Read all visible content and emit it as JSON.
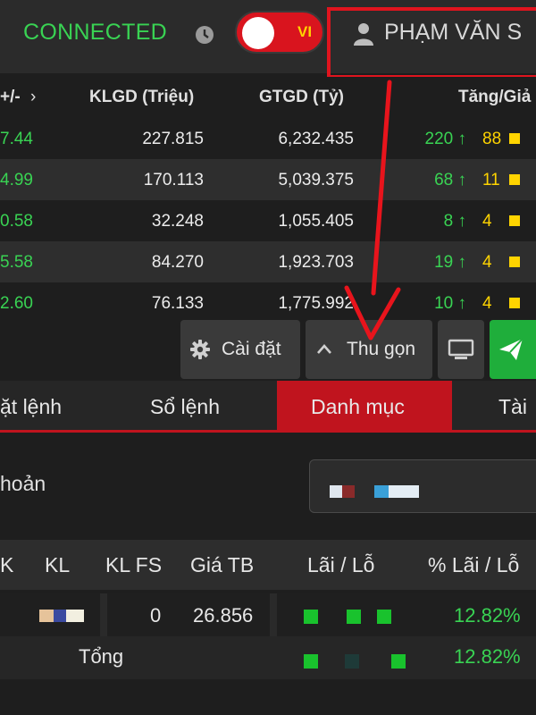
{
  "header": {
    "status": "CONNECTED",
    "language": "VI",
    "user_name": "PHẠM VĂN S"
  },
  "market": {
    "columns": {
      "change": "+/-",
      "klgd": "KLGD (Triệu)",
      "gtgd": "GTGD (Tỷ)",
      "updown": "Tăng/Giả"
    },
    "rows": [
      {
        "change": "7.44",
        "klgd": "227.815",
        "gtgd": "6,232.435",
        "up": "220",
        "ref": "88"
      },
      {
        "change": "4.99",
        "klgd": "170.113",
        "gtgd": "5,039.375",
        "up": "68",
        "ref": "11"
      },
      {
        "change": "0.58",
        "klgd": "32.248",
        "gtgd": "1,055.405",
        "up": "8",
        "ref": "4"
      },
      {
        "change": "5.58",
        "klgd": "84.270",
        "gtgd": "1,923.703",
        "up": "19",
        "ref": "4"
      },
      {
        "change": "2.60",
        "klgd": "76.133",
        "gtgd": "1,775.992",
        "up": "10",
        "ref": "4"
      }
    ]
  },
  "actions": {
    "settings": "Cài đặt",
    "collapse": "Thu gọn"
  },
  "tabs": {
    "order": "ặt lệnh",
    "orderbook": "Sổ lệnh",
    "portfolio": "Danh mục",
    "asset": "Tài"
  },
  "account": {
    "label": "hoản"
  },
  "portfolio": {
    "columns": {
      "k": "K",
      "kl": "KL",
      "klfs": "KL FS",
      "avg": "Giá TB",
      "pl": "Lãi / Lỗ",
      "plpct": "% Lãi / Lỗ"
    },
    "row": {
      "klfs": "0",
      "avg": "26.856",
      "plpct": "12.82%"
    },
    "total": {
      "label": "Tổng",
      "plpct": "12.82%"
    }
  },
  "colors": {
    "accent_red": "#c0141e",
    "up_green": "#39d353",
    "ref_yellow": "#ffd400",
    "send_green": "#1fae3b"
  }
}
